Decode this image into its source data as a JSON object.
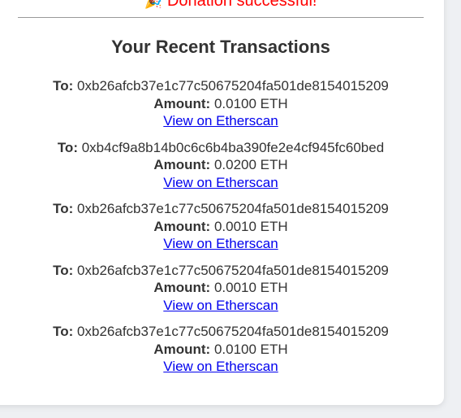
{
  "status": {
    "icon": "party-popper-icon",
    "message": "Donation successful!",
    "color": "#ff0000"
  },
  "heading": "Your Recent Transactions",
  "labels": {
    "to": "To:",
    "amount": "Amount:"
  },
  "transactions": [
    {
      "to": "0xb26afcb37e1c77c50675204fa501de8154015209",
      "amount": "0.0100 ETH",
      "link": "View on Etherscan"
    },
    {
      "to": "0xb4cf9a8b14b0c6c6b4ba390fe2e4cf945fc60bed",
      "amount": "0.0200 ETH",
      "link": "View on Etherscan"
    },
    {
      "to": "0xb26afcb37e1c77c50675204fa501de8154015209",
      "amount": "0.0010 ETH",
      "link": "View on Etherscan"
    },
    {
      "to": "0xb26afcb37e1c77c50675204fa501de8154015209",
      "amount": "0.0010 ETH",
      "link": "View on Etherscan"
    },
    {
      "to": "0xb26afcb37e1c77c50675204fa501de8154015209",
      "amount": "0.0100 ETH",
      "link": "View on Etherscan"
    }
  ],
  "colors": {
    "link": "#0000ee",
    "text": "#333333",
    "page_background": "#eef0f3",
    "card_background": "#ffffff"
  }
}
